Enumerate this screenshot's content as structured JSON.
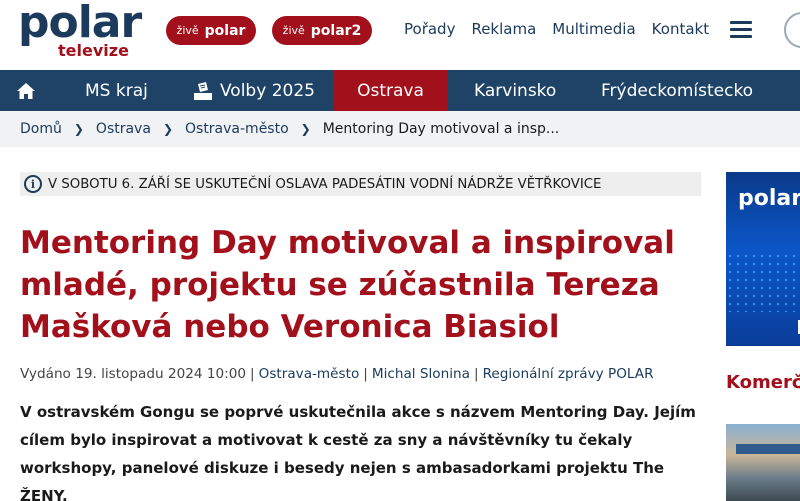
{
  "header": {
    "logo_main": "polar",
    "logo_sub": "televize",
    "live1": {
      "small": "živě",
      "big": "polar"
    },
    "live2": {
      "small": "živě",
      "big": "polar2"
    },
    "topnav": [
      "Pořady",
      "Reklama",
      "Multimedia",
      "Kontakt"
    ]
  },
  "navbar": {
    "items": [
      "MS kraj",
      "Volby 2025",
      "Ostrava",
      "Karvinsko",
      "Frýdeckomístecko"
    ],
    "active": "Ostrava"
  },
  "breadcrumb": [
    "Domů",
    "Ostrava",
    "Ostrava-město",
    "Mentoring Day motivoval a insp..."
  ],
  "info_banner": "V SOBOTU 6. ZÁŘÍ SE USKUTEČNÍ OSLAVA PADESÁTIN VODNÍ NÁDRŽE VĚTŘKOVICE",
  "article": {
    "title_lines": [
      "Mentoring Day motivoval a inspiroval",
      "mladé, projektu se zúčastnila Tereza",
      "Mašková nebo Veronica Biasiol"
    ],
    "published": "Vydáno 19. listopadu 2024 10:00",
    "section": "Ostrava-město",
    "author": "Michal Slonina",
    "category": "Regionální zprávy POLAR",
    "lead_lines": [
      "V ostravském Gongu se poprvé uskutečnila akce s názvem Mentoring Day. Jejím",
      "cílem bylo inspirovat a motivovat k cestě za sny a návštěvníky tu čekaly",
      "workshopy, panelové diskuze i besedy nejen s ambasadorkami projektu The",
      "ŽENY."
    ]
  },
  "sidebar": {
    "ad_logo": "polar",
    "heading": "Komerč"
  },
  "colors": {
    "brand_red": "#a2101c",
    "brand_blue": "#1f4366",
    "text_blue": "#1b3a5c"
  }
}
